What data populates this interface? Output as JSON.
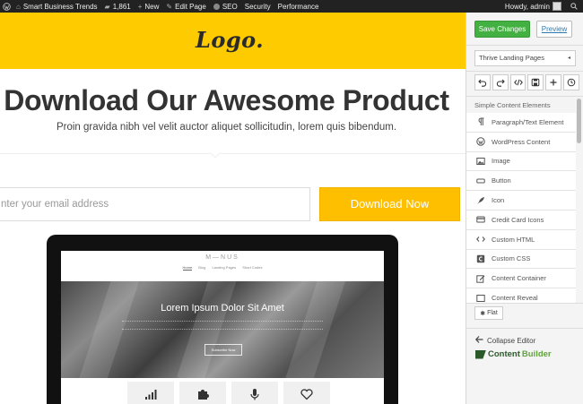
{
  "adminbar": {
    "site_name": "Smart Business Trends",
    "comments_count": "1,861",
    "new_label": "New",
    "edit_page_label": "Edit Page",
    "seo_label": "SEO",
    "security_label": "Security",
    "performance_label": "Performance",
    "howdy_label": "Howdy, admin"
  },
  "page": {
    "logo_text": "Logo.",
    "headline": "Download Our Awesome Product",
    "subheadline": "Proin gravida nibh vel velit auctor aliquet sollicitudin, lorem quis bibendum.",
    "email_placeholder": "nter your email address",
    "download_label": "Download Now",
    "colors": {
      "brand_yellow": "#fdcb00",
      "button_yellow": "#fdbf00"
    }
  },
  "laptop": {
    "mini_logo": "M—NUS",
    "nav": [
      "Home",
      "Blog",
      "Landing Pages",
      "Short Codes"
    ],
    "hero_title": "Lorem Ipsum Dolor Sit Amet",
    "hero_button": "Subscribe Now",
    "features": [
      "signal-bars-icon",
      "puzzle-icon",
      "microphone-icon",
      "heart-icon"
    ]
  },
  "sidebar": {
    "save_label": "Save Changes",
    "preview_label": "Preview",
    "template_select": "Thrive Landing Pages",
    "toolbar": [
      "undo-icon",
      "redo-icon",
      "code-icon",
      "save-template-icon",
      "add-icon",
      "history-icon"
    ],
    "elements_title": "Simple Content Elements",
    "elements": [
      {
        "label": "Paragraph/Text Element",
        "icon": "paragraph-icon"
      },
      {
        "label": "WordPress Content",
        "icon": "wordpress-icon"
      },
      {
        "label": "Image",
        "icon": "image-icon"
      },
      {
        "label": "Button",
        "icon": "button-icon"
      },
      {
        "label": "Icon",
        "icon": "rocket-icon"
      },
      {
        "label": "Credit Card Icons",
        "icon": "credit-card-icon"
      },
      {
        "label": "Custom HTML",
        "icon": "code-icon"
      },
      {
        "label": "Custom CSS",
        "icon": "css-icon"
      },
      {
        "label": "Content Container",
        "icon": "edit-icon"
      },
      {
        "label": "Content Reveal",
        "icon": "reveal-icon"
      }
    ],
    "flat_label": "Flat",
    "collapse_label": "Collapse Editor",
    "brand_part1": "Content",
    "brand_part2": "Builder",
    "colors": {
      "save_green": "#43b141",
      "brand_dark": "#2a5a2a",
      "brand_light": "#61a33b"
    }
  }
}
